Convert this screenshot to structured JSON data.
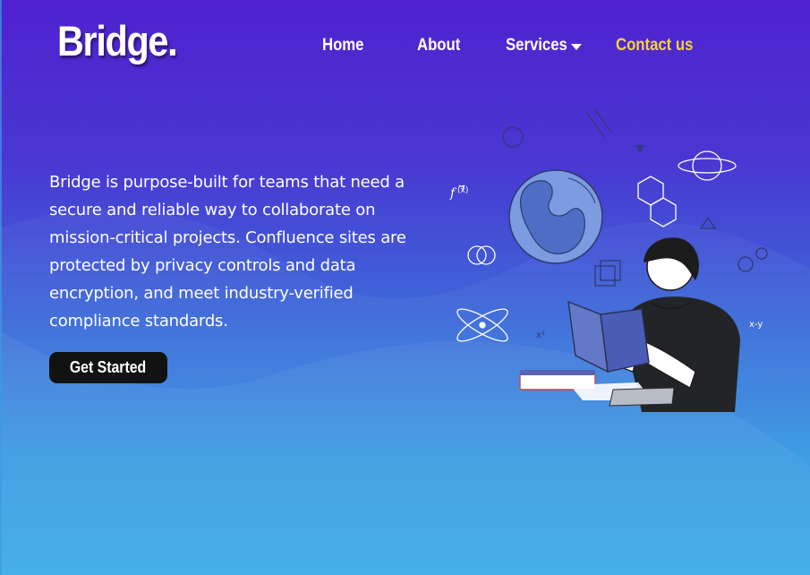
{
  "header": {
    "logo": "Bridge.",
    "nav": [
      {
        "label": "Home"
      },
      {
        "label": "About"
      },
      {
        "label": "Services",
        "icon": "chevron-down-icon"
      },
      {
        "label": "Contact us",
        "highlight_color": "#f7d23e"
      }
    ]
  },
  "hero": {
    "description": "Bridge is purpose-built for teams that need a secure and reliable way to collaborate on mission-critical projects. Confluence sites are protected by privacy controls and data encryption, and meet industry-verified compliance standards.",
    "cta_label": "Get Started",
    "illustration": "person-reading-book-with-science-doodles"
  },
  "colors": {
    "background_top": "#4f22cf",
    "background_bottom": "#36a9e5",
    "accent": "#f7d23e",
    "button": "#121212"
  }
}
